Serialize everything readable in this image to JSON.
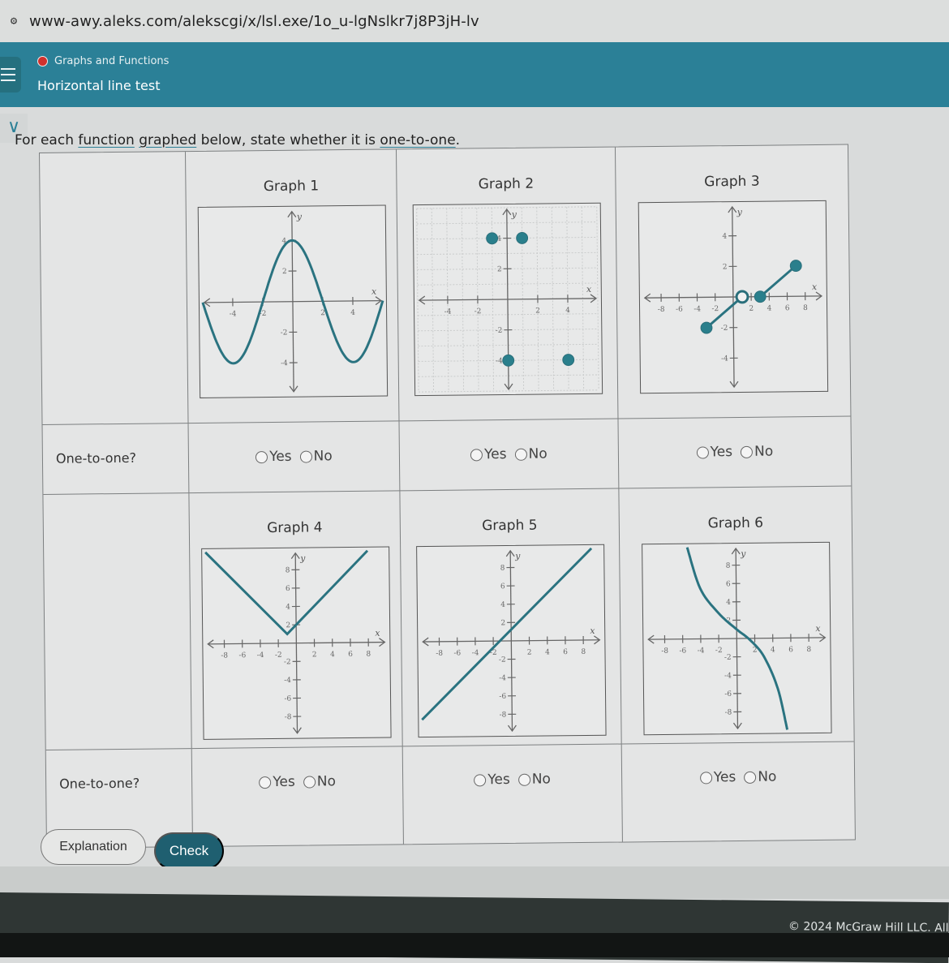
{
  "browser": {
    "url": "www-awy.aleks.com/alekscgi/x/lsl.exe/1o_u-lgNslkr7j8P3jH-lv",
    "site_icon": "tune-icon"
  },
  "header": {
    "topic": "Graphs and Functions",
    "subtopic": "Horizontal line test",
    "status_color": "#d0312d",
    "brand_color": "#2b8097"
  },
  "instructions": {
    "prefix": "For each ",
    "link1": "function",
    "space": " ",
    "link2": "graphed",
    "middle": " below, state whether it is ",
    "link3": "one-to-one",
    "suffix": "."
  },
  "question_label": "One-to-one?",
  "options": {
    "yes": "Yes",
    "no": "No"
  },
  "buttons": {
    "explanation": "Explanation",
    "check": "Check"
  },
  "footer": {
    "copyright": "© 2024 McGraw Hill LLC. All"
  },
  "chart_data": [
    {
      "title": "Graph 1",
      "type": "line",
      "description": "Cosine-like wave",
      "xlabel": "x",
      "ylabel": "y",
      "xlim": [
        -6,
        6
      ],
      "ylim": [
        -6,
        6
      ],
      "xticks": [
        -4,
        -2,
        2,
        4
      ],
      "yticks": [
        -4,
        -2,
        2,
        4
      ],
      "grid": false,
      "curve": {
        "kind": "function",
        "formula": "4cos(pi*x/4)",
        "x": [
          -6,
          -4,
          -2,
          0,
          2,
          4,
          6
        ],
        "y": [
          0,
          -4,
          0,
          4,
          0,
          -4,
          0
        ]
      },
      "points": [],
      "answer": null
    },
    {
      "title": "Graph 2",
      "type": "scatter",
      "description": "Four discrete points",
      "xlabel": "x",
      "ylabel": "y",
      "xlim": [
        -6,
        6
      ],
      "ylim": [
        -6,
        6
      ],
      "xticks": [
        -4,
        -2,
        2,
        4
      ],
      "yticks": [
        -4,
        -2,
        2,
        4
      ],
      "grid": true,
      "points": [
        {
          "x": -1,
          "y": 4,
          "filled": true
        },
        {
          "x": 1,
          "y": 4,
          "filled": true
        },
        {
          "x": 0,
          "y": -4,
          "filled": true
        },
        {
          "x": 4,
          "y": -4,
          "filled": true
        }
      ],
      "answer": null
    },
    {
      "title": "Graph 3",
      "type": "line",
      "description": "Two segments with endpoints",
      "xlabel": "x",
      "ylabel": "y",
      "xlim": [
        -10,
        10
      ],
      "ylim": [
        -6,
        6
      ],
      "xticks": [
        -8,
        -6,
        -4,
        -2,
        2,
        4,
        6,
        8
      ],
      "yticks": [
        -4,
        -2,
        2,
        4
      ],
      "grid": false,
      "segments": [
        {
          "x": [
            -3,
            1
          ],
          "y": [
            -2,
            0
          ]
        },
        {
          "x": [
            3,
            7
          ],
          "y": [
            0,
            2
          ]
        }
      ],
      "points": [
        {
          "x": -3,
          "y": -2,
          "filled": true
        },
        {
          "x": 1,
          "y": 0,
          "filled": false
        },
        {
          "x": 3,
          "y": 0,
          "filled": true
        },
        {
          "x": 7,
          "y": 2,
          "filled": true
        }
      ],
      "answer": null
    },
    {
      "title": "Graph 4",
      "type": "line",
      "description": "V-shaped absolute value",
      "xlabel": "x",
      "ylabel": "y",
      "xlim": [
        -10,
        10
      ],
      "ylim": [
        -10,
        10
      ],
      "xticks": [
        -8,
        -6,
        -4,
        -2,
        2,
        4,
        6,
        8
      ],
      "yticks": [
        -8,
        -6,
        -4,
        -2,
        2,
        4,
        6,
        8
      ],
      "grid": false,
      "curve": {
        "kind": "polyline",
        "x": [
          -10,
          -1,
          8
        ],
        "y": [
          10,
          1,
          10
        ]
      },
      "points": [],
      "answer": null
    },
    {
      "title": "Graph 5",
      "type": "line",
      "description": "Increasing straight line",
      "xlabel": "x",
      "ylabel": "y",
      "xlim": [
        -10,
        10
      ],
      "ylim": [
        -10,
        10
      ],
      "xticks": [
        -8,
        -6,
        -4,
        -2,
        2,
        4,
        6,
        8
      ],
      "yticks": [
        -8,
        -6,
        -4,
        -2,
        2,
        4,
        6,
        8
      ],
      "grid": false,
      "curve": {
        "kind": "polyline",
        "x": [
          -10,
          9
        ],
        "y": [
          -8.5,
          10
        ]
      },
      "points": [],
      "answer": null
    },
    {
      "title": "Graph 6",
      "type": "line",
      "description": "Decreasing cubic-like curve",
      "xlabel": "x",
      "ylabel": "y",
      "xlim": [
        -10,
        10
      ],
      "ylim": [
        -10,
        10
      ],
      "xticks": [
        -8,
        -6,
        -4,
        -2,
        2,
        4,
        6,
        8
      ],
      "yticks": [
        -8,
        -6,
        -4,
        -2,
        2,
        4,
        6,
        8
      ],
      "grid": false,
      "curve": {
        "kind": "polyline",
        "x": [
          -5.4,
          -4,
          -2,
          0,
          1.5,
          3,
          4.5,
          5.5
        ],
        "y": [
          10,
          5.5,
          2.8,
          1,
          -0.2,
          -2,
          -5.5,
          -10
        ]
      },
      "points": [],
      "answer": null
    }
  ]
}
